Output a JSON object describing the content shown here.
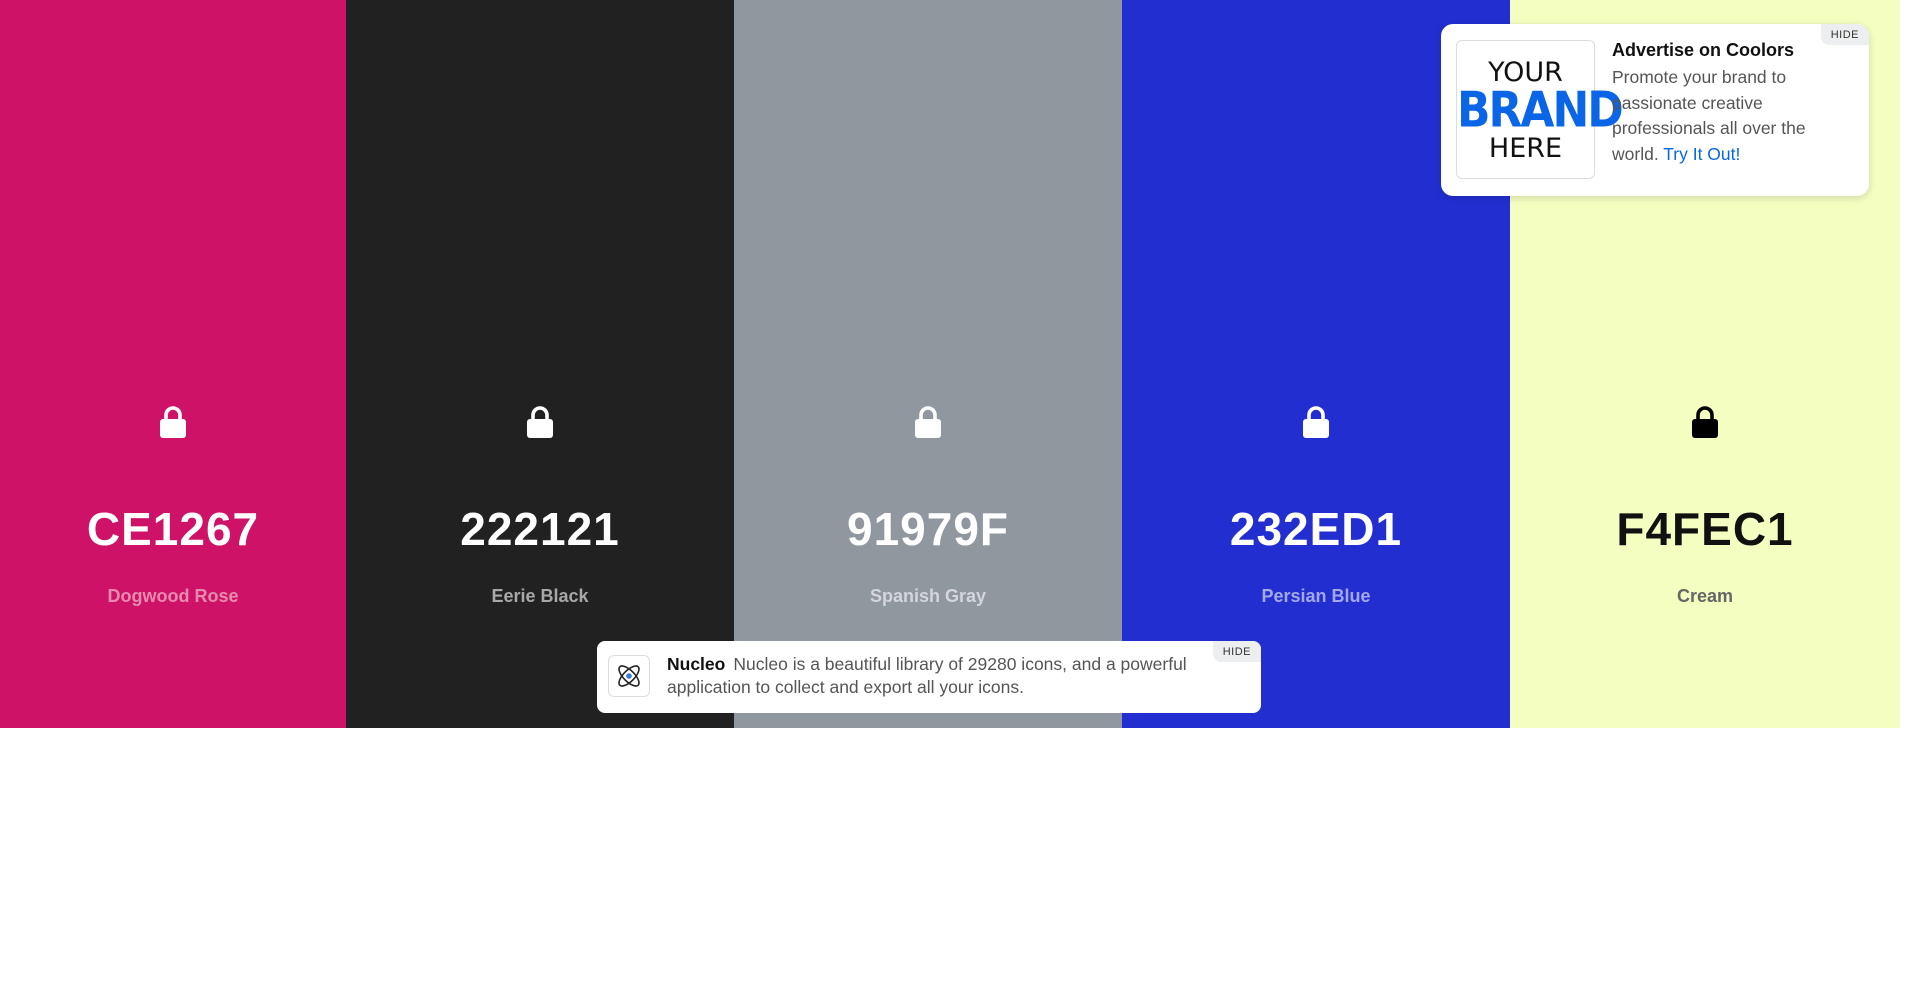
{
  "palette": {
    "colors": [
      {
        "hex": "CE1267",
        "name": "Dogwood Rose",
        "bg": "#CE1267",
        "fg": "#ffffff",
        "name_color": "#e88ab0",
        "lock_color": "#ffffff"
      },
      {
        "hex": "222121",
        "name": "Eerie Black",
        "bg": "#222121",
        "fg": "#ffffff",
        "name_color": "#a8a8a8",
        "lock_color": "#ffffff"
      },
      {
        "hex": "91979F",
        "name": "Spanish Gray",
        "bg": "#91979F",
        "fg": "#ffffff",
        "name_color": "#d3d6da",
        "lock_color": "#ffffff"
      },
      {
        "hex": "232ED1",
        "name": "Persian Blue",
        "bg": "#232ED1",
        "fg": "#ffffff",
        "name_color": "#a2a8ec",
        "lock_color": "#ffffff"
      },
      {
        "hex": "F4FEC1",
        "name": "Cream",
        "bg": "#F4FEC1",
        "fg": "#111111",
        "name_color": "#666666",
        "lock_color": "#000000"
      }
    ]
  },
  "ad_card": {
    "logo_line1": "YOUR",
    "logo_line2": "BRAND",
    "logo_line3": "HERE",
    "title": "Advertise on Coolors",
    "body": "Promote your brand to passionate creative professionals all over the world.",
    "link": "Try It Out!",
    "hide_label": "HIDE",
    "link_color": "#0a66e6"
  },
  "ad_bottom": {
    "icon": "atom-icon",
    "brand": "Nucleo",
    "text": "Nucleo is a beautiful library of 29280 icons, and a powerful application to collect and export all your icons.",
    "hide_label": "HIDE"
  }
}
